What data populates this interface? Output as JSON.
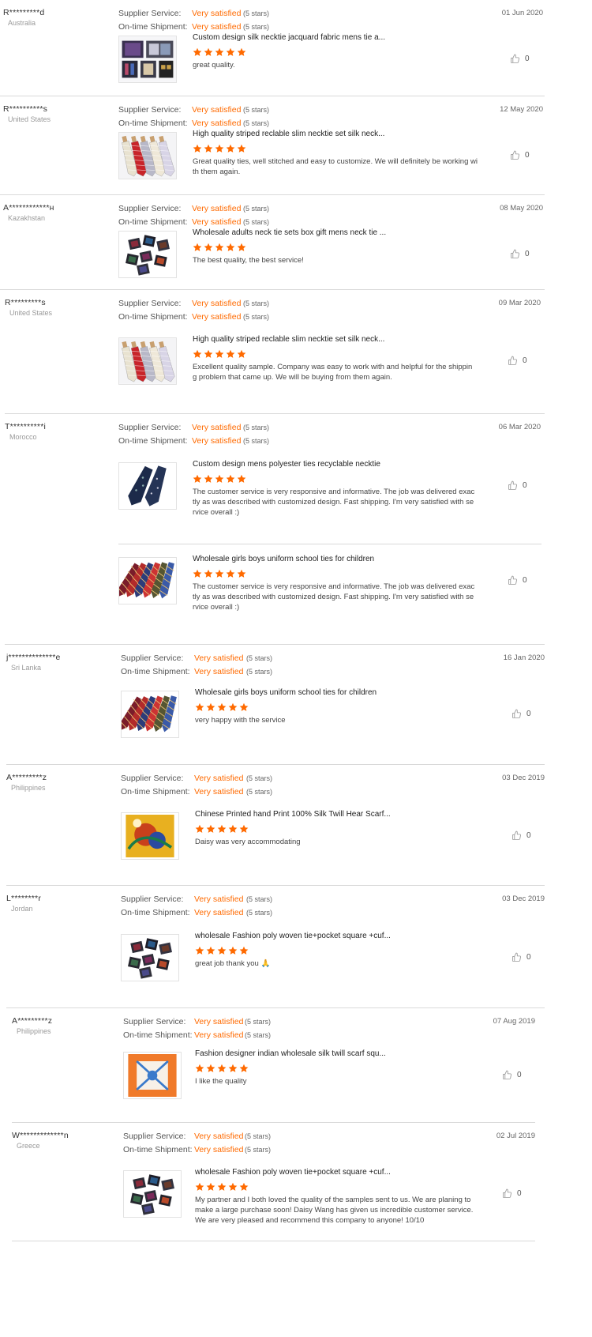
{
  "labels": {
    "supplier_service": "Supplier Service:",
    "ontime_shipment": "On-time Shipment:"
  },
  "colors": {
    "accent": "#ff6a00",
    "divider": "#d9d9d9"
  },
  "reviews": [
    {
      "name": "R*********d",
      "country": "Australia",
      "date": "01 Jun 2020",
      "supplier_rating": "Very satisfied",
      "supplier_stars": "(5 stars)",
      "shipment_rating": "Very satisfied",
      "shipment_stars": "(5 stars)",
      "items": [
        {
          "title": "Custom design silk necktie jacquard fabric mens tie a...",
          "stars": 5,
          "comment": "great quality.",
          "likes": "0",
          "image": "tie-box-set"
        }
      ]
    },
    {
      "name": "R**********s",
      "country": "United States",
      "date": "12 May 2020",
      "supplier_rating": "Very satisfied",
      "supplier_stars": "(5 stars)",
      "shipment_rating": "Very satisfied",
      "shipment_stars": "(5 stars)",
      "items": [
        {
          "title": "High quality striped reclable slim necktie set silk neck...",
          "stars": 5,
          "comment": "Great quality ties, well stitched and easy to customize. We will definitely be working with them again.",
          "likes": "0",
          "image": "striped-ties"
        }
      ]
    },
    {
      "name": "A************н",
      "country": "Kazakhstan",
      "date": "08 May 2020",
      "supplier_rating": "Very satisfied",
      "supplier_stars": "(5 stars)",
      "shipment_rating": "Very satisfied",
      "shipment_stars": "(5 stars)",
      "items": [
        {
          "title": "Wholesale adults neck tie sets box gift mens neck tie ...",
          "stars": 5,
          "comment": "The best quality, the best service!",
          "likes": "0",
          "image": "gift-boxes"
        }
      ]
    },
    {
      "name": "R*********s",
      "country": "United States",
      "date": "09 Mar 2020",
      "supplier_rating": "Very satisfied",
      "supplier_stars": "(5 stars)",
      "shipment_rating": "Very satisfied",
      "shipment_stars": "(5 stars)",
      "items": [
        {
          "title": "High quality striped reclable slim necktie set silk neck...",
          "stars": 5,
          "comment": "Excellent quality sample. Company was easy to work with and helpful for the shipping problem that came up. We will be buying from them again.",
          "likes": "0",
          "image": "striped-ties"
        }
      ]
    },
    {
      "name": "T**********i",
      "country": "Morocco",
      "date": "06 Mar 2020",
      "supplier_rating": "Very satisfied",
      "supplier_stars": "(5 stars)",
      "shipment_rating": "Very satisfied",
      "shipment_stars": "(5 stars)",
      "items": [
        {
          "title": "Custom design mens polyester ties recyclable necktie",
          "stars": 5,
          "comment": "The customer service is very responsive and informative. The job was delivered exactly as was described with customized design. Fast shipping. I'm very satisfied with service overall :)",
          "likes": "0",
          "image": "navy-ties"
        },
        {
          "title": "Wholesale girls boys uniform school ties for children",
          "stars": 5,
          "comment": "The customer service is very responsive and informative. The job was delivered exactly as was described with customized design. Fast shipping. I'm very satisfied with service overall :)",
          "likes": "0",
          "image": "school-ties"
        }
      ]
    },
    {
      "name": "j**************e",
      "country": "Sri Lanka",
      "date": "16 Jan 2020",
      "supplier_rating": "Very satisfied",
      "supplier_stars": "(5 stars)",
      "shipment_rating": "Very satisfied",
      "shipment_stars": "(5 stars)",
      "items": [
        {
          "title": "Wholesale girls boys uniform school ties for children",
          "stars": 5,
          "comment": "very happy with the service",
          "likes": "0",
          "image": "school-ties"
        }
      ]
    },
    {
      "name": "A*********z",
      "country": "Philippines",
      "date": "03 Dec 2019",
      "supplier_rating": "Very satisfied",
      "supplier_stars": "(5 stars)",
      "shipment_rating": "Very satisfied",
      "shipment_stars": "(5 stars)",
      "items": [
        {
          "title": "Chinese Printed hand Print 100% Silk Twill Hear Scarf...",
          "stars": 5,
          "comment": "Daisy was very accommodating",
          "likes": "0",
          "image": "silk-scarf-yellow"
        }
      ]
    },
    {
      "name": "L********r",
      "country": "Jordan",
      "date": "03 Dec 2019",
      "supplier_rating": "Very satisfied",
      "supplier_stars": "(5 stars)",
      "shipment_rating": "Very satisfied",
      "shipment_stars": "(5 stars)",
      "items": [
        {
          "title": "wholesale Fashion poly woven tie+pocket square +cuf...",
          "stars": 5,
          "comment": "great job thank you 🙏",
          "likes": "0",
          "image": "gift-boxes"
        }
      ]
    },
    {
      "name": "A*********z",
      "country": "Philippines",
      "date": "07 Aug 2019",
      "supplier_rating": "Very satisfied",
      "supplier_stars": "(5 stars)",
      "shipment_rating": "Very satisfied",
      "shipment_stars": "(5 stars)",
      "items": [
        {
          "title": "Fashion designer indian wholesale silk twill scarf squ...",
          "stars": 5,
          "comment": "I like the quality",
          "likes": "0",
          "image": "silk-scarf-orange"
        }
      ]
    },
    {
      "name": "W*************n",
      "country": "Greece",
      "date": "02 Jul 2019",
      "supplier_rating": "Very satisfied",
      "supplier_stars": "(5 stars)",
      "shipment_rating": "Very satisfied",
      "shipment_stars": "(5 stars)",
      "items": [
        {
          "title": "wholesale Fashion poly woven tie+pocket square +cuf...",
          "stars": 5,
          "comment": "My partner and I both loved the quality of the samples sent to us. We are planing to make a large purchase soon! Daisy Wang has given us incredible customer service. We are very pleased and recommend this company to anyone! 10/10",
          "likes": "0",
          "image": "gift-boxes"
        }
      ]
    }
  ]
}
